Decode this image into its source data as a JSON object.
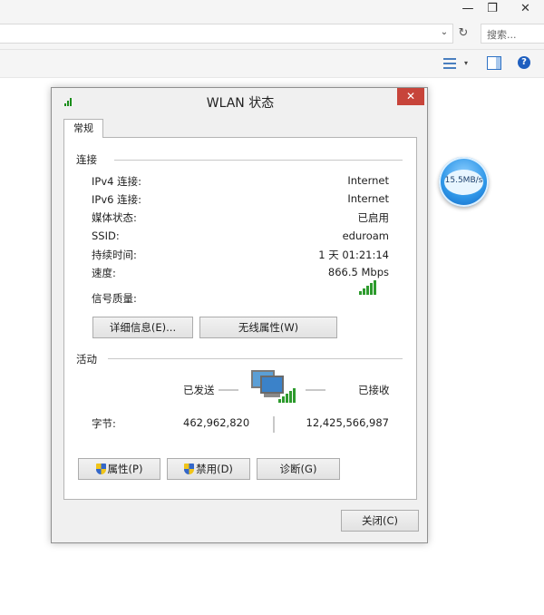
{
  "background_window": {
    "controls": {
      "minimize": "—",
      "maximize": "❐",
      "close": "✕"
    },
    "search": {
      "placeholder": "搜索..."
    },
    "toolbar": {
      "help": "?"
    }
  },
  "speed_bubble": {
    "text": "15.5MB/s"
  },
  "dialog": {
    "title": "WLAN 状态",
    "close": "✕",
    "tab": "常规",
    "connection": {
      "heading": "连接",
      "rows": [
        {
          "label": "IPv4 连接:",
          "value": "Internet"
        },
        {
          "label": "IPv6 连接:",
          "value": "Internet"
        },
        {
          "label": "媒体状态:",
          "value": "已启用"
        },
        {
          "label": "SSID:",
          "value": "eduroam"
        },
        {
          "label": "持续时间:",
          "value": "1 天 01:21:14"
        },
        {
          "label": "速度:",
          "value": "866.5 Mbps"
        }
      ],
      "signal_label": "信号质量:",
      "signal_bars": 5,
      "details_button": "详细信息(E)...",
      "wireless_props_button": "无线属性(W)"
    },
    "activity": {
      "heading": "活动",
      "sent_label": "已发送",
      "received_label": "已接收",
      "bytes_label": "字节:",
      "bytes_sent": "462,962,820",
      "bytes_received": "12,425,566,987"
    },
    "buttons": {
      "properties": "属性(P)",
      "disable": "禁用(D)",
      "diagnose": "诊断(G)",
      "close": "关闭(C)"
    }
  },
  "colors": {
    "close_red": "#c7443a",
    "signal_green": "#2e9b2e",
    "speed_blue": "#2f97e8"
  }
}
